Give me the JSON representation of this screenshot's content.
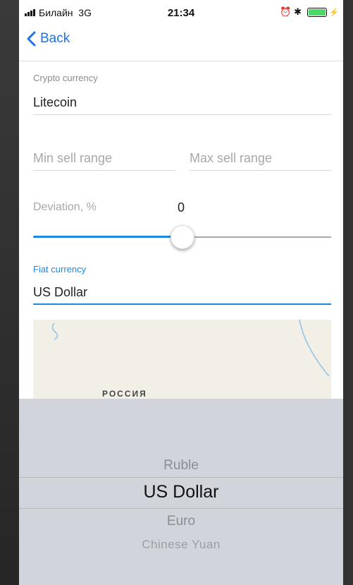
{
  "status_bar": {
    "carrier": "Билайн",
    "network": "3G",
    "time": "21:34"
  },
  "nav": {
    "back_label": "Back"
  },
  "form": {
    "crypto": {
      "label": "Crypto currency",
      "value": "Litecoin"
    },
    "min_sell": {
      "placeholder": "Min sell range"
    },
    "max_sell": {
      "placeholder": "Max sell range"
    },
    "deviation": {
      "label": "Deviation, %",
      "value": "0"
    },
    "fiat": {
      "label": "Fiat currency",
      "value": "US Dollar"
    }
  },
  "map": {
    "label": "РОССИЯ"
  },
  "picker": {
    "options": [
      "Ruble",
      "US Dollar",
      "Euro",
      "Chinese Yuan"
    ],
    "selected": "US Dollar"
  },
  "colors": {
    "accent": "#1e88e5",
    "picker_bg": "#d1d4da"
  }
}
